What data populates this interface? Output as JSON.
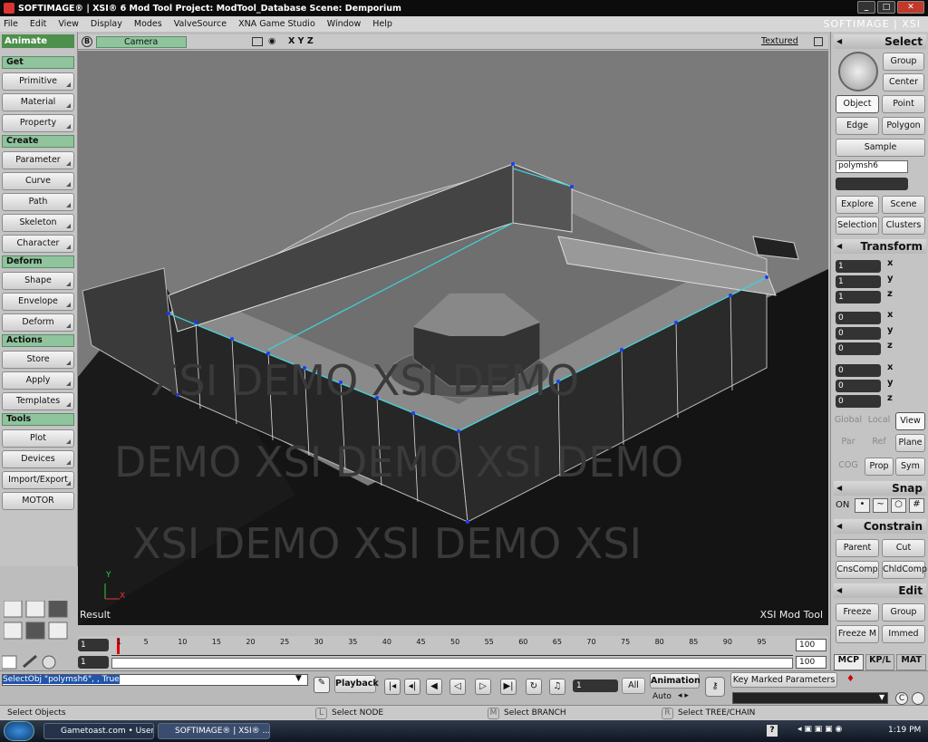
{
  "window": {
    "title": "SOFTIMAGE® | XSI® 6 Mod Tool Project: ModTool_Database    Scene: Demporium",
    "brand": "SOFTIMAGE | XSI"
  },
  "menu": [
    "File",
    "Edit",
    "View",
    "Display",
    "Modes",
    "ValveSource",
    "XNA Game Studio",
    "Window",
    "Help"
  ],
  "left": {
    "mode": "Animate",
    "sections": {
      "get": "Get",
      "create": "Create",
      "deform": "Deform",
      "actions": "Actions",
      "tools": "Tools"
    },
    "get": [
      "Primitive",
      "Material",
      "Property"
    ],
    "create": [
      "Parameter",
      "Curve",
      "Path",
      "Skeleton",
      "Character"
    ],
    "deform": [
      "Shape",
      "Envelope",
      "Deform"
    ],
    "actions": [
      "Store",
      "Apply",
      "Templates"
    ],
    "tools": [
      "Plot",
      "Devices",
      "Import/Export",
      "MOTOR"
    ]
  },
  "viewport": {
    "camera": "Camera",
    "xyz": "X Y Z",
    "shading": "Textured",
    "result_label": "Result",
    "brand_label": "XSI Mod Tool",
    "watermark": "XSI DEMO"
  },
  "right": {
    "select_title": "Select",
    "select_btns": [
      "Group",
      "Center"
    ],
    "modes": [
      "Object",
      "Point",
      "Edge",
      "Polygon"
    ],
    "sample": "Sample",
    "object_name": "polymsh6",
    "explore": [
      "Explore",
      "Scene",
      "Selection",
      "Clusters"
    ],
    "transform_title": "Transform",
    "scale": [
      "1",
      "1",
      "1"
    ],
    "rotate": [
      "0",
      "0",
      "0"
    ],
    "translate": [
      "0",
      "0",
      "0"
    ],
    "axes": [
      "x",
      "y",
      "z"
    ],
    "ref_modes": [
      "Global",
      "Local",
      "View"
    ],
    "ref_modes2": [
      "Par",
      "Ref",
      "Plane"
    ],
    "cog": [
      "COG",
      "Prop",
      "Sym"
    ],
    "snap_title": "Snap",
    "snap_on": "ON",
    "constrain_title": "Constrain",
    "constrain_btns": [
      "Parent",
      "Cut",
      "CnsComp",
      "ChldComp"
    ],
    "edit_title": "Edit",
    "edit_btns": [
      "Freeze",
      "Group",
      "Freeze M",
      "Immed"
    ],
    "tabs": [
      "MCP",
      "KP/L",
      "MAT"
    ]
  },
  "timeline": {
    "start": "1",
    "start2": "1",
    "end": "100",
    "end2": "100",
    "ticks": [
      "1",
      "5",
      "10",
      "15",
      "20",
      "25",
      "30",
      "35",
      "40",
      "45",
      "50",
      "55",
      "60",
      "65",
      "70",
      "75",
      "80",
      "85",
      "90",
      "95"
    ]
  },
  "cmd": {
    "text": "SelectObj \"polymsh6\", , True",
    "playback": "Playback",
    "frame": "1",
    "all": "All",
    "animation": "Animation",
    "auto": "Auto",
    "key_marked": "Key Marked Parameters"
  },
  "status": {
    "left": "Select Objects",
    "l": "Select NODE",
    "m": "Select BRANCH",
    "r": "Select TREE/CHAIN",
    "l_key": "L",
    "m_key": "M",
    "r_key": "R"
  },
  "taskbar": {
    "task1": "Gametoast.com • User...",
    "task2": "SOFTIMAGE® | XSI® ...",
    "time": "1:19 PM"
  }
}
